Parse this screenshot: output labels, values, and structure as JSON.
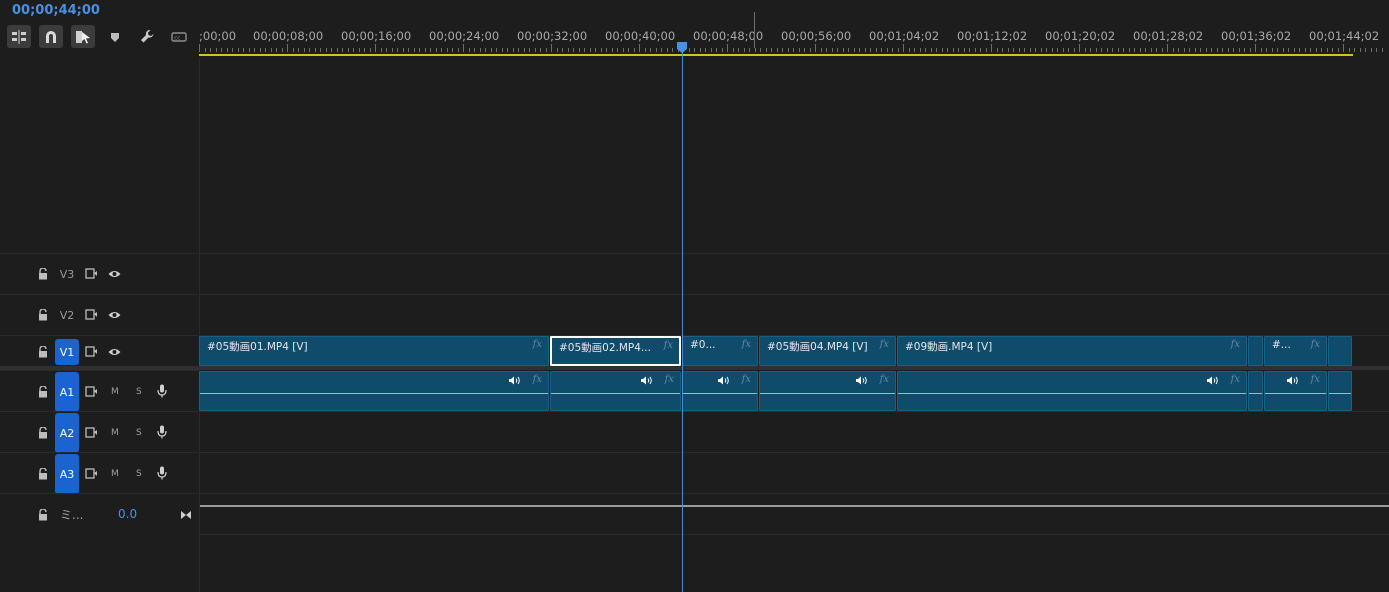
{
  "timecode": "00;00;44;00",
  "tools": [
    {
      "name": "insert-sequence-icon",
      "active": true
    },
    {
      "name": "snap-magnet-icon",
      "active": true
    },
    {
      "name": "linked-selection-icon",
      "active": true
    },
    {
      "name": "add-marker-icon",
      "active": false
    },
    {
      "name": "wrench-settings-icon",
      "active": false
    },
    {
      "name": "captions-icon",
      "active": false
    }
  ],
  "ruler": {
    "labels": [
      ";00;00",
      "00;00;08;00",
      "00;00;16;00",
      "00;00;24;00",
      "00;00;32;00",
      "00;00;40;00",
      "00;00;48;00",
      "00;00;56;00",
      "00;01;04;02",
      "00;01;12;02",
      "00;01;20;02",
      "00;01;28;02",
      "00;01;36;02",
      "00;01;44;02"
    ]
  },
  "tracks": {
    "video": [
      {
        "id": "V3",
        "label": "V3",
        "targeted": false
      },
      {
        "id": "V2",
        "label": "V2",
        "targeted": false
      },
      {
        "id": "V1",
        "label": "V1",
        "targeted": true
      }
    ],
    "audio": [
      {
        "id": "A1",
        "label": "A1",
        "targeted": true,
        "mute": "M",
        "solo": "S"
      },
      {
        "id": "A2",
        "label": "A2",
        "targeted": true,
        "mute": "M",
        "solo": "S"
      },
      {
        "id": "A3",
        "label": "A3",
        "targeted": true,
        "mute": "M",
        "solo": "S"
      }
    ],
    "master": {
      "name": "ミ...",
      "value": "0.0"
    }
  },
  "clips": {
    "v1": [
      {
        "name": "#05動画01.MP4 [V]",
        "fx": "fx",
        "selected": false
      },
      {
        "name": "#05動画02.MP4...",
        "fx": "fx",
        "selected": true
      },
      {
        "name": "#0...",
        "fx": "fx",
        "selected": false
      },
      {
        "name": "#05動画04.MP4 [V]",
        "fx": "fx",
        "selected": false
      },
      {
        "name": "#09動画.MP4 [V]",
        "fx": "fx",
        "selected": false
      },
      {
        "name": "",
        "fx": "",
        "selected": false
      },
      {
        "name": "#...",
        "fx": "fx",
        "selected": false
      },
      {
        "name": "",
        "fx": "",
        "selected": false
      }
    ],
    "a1": [
      {
        "fx": "fx",
        "audio_icon": true
      },
      {
        "fx": "fx",
        "audio_icon": true
      },
      {
        "fx": "fx",
        "audio_icon": true
      },
      {
        "fx": "fx",
        "audio_icon": true
      },
      {
        "fx": "fx",
        "audio_icon": true
      },
      {
        "fx": "",
        "audio_icon": false
      },
      {
        "fx": "fx",
        "audio_icon": true
      },
      {
        "fx": "",
        "audio_icon": false
      }
    ]
  },
  "colors": {
    "accent": "#4a90e2",
    "clip_fill": "#0f4c6c",
    "track_target": "#1a64d2",
    "work_area": "#d4c21f"
  }
}
